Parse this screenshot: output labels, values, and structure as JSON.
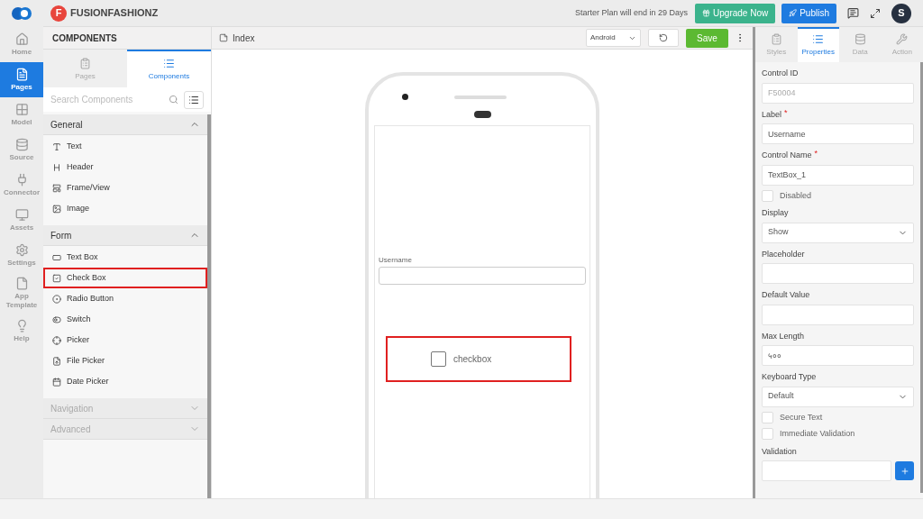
{
  "rail": {
    "items": [
      {
        "label": "Home",
        "selected": false
      },
      {
        "label": "Pages",
        "selected": true
      },
      {
        "label": "Model",
        "selected": false
      },
      {
        "label": "Source",
        "selected": false
      },
      {
        "label": "Connector",
        "selected": false
      },
      {
        "label": "Assets",
        "selected": false
      },
      {
        "label": "Settings",
        "selected": false
      },
      {
        "label": "App Template",
        "selected": false
      },
      {
        "label": "Help",
        "selected": false
      }
    ]
  },
  "brand": {
    "initial": "F",
    "name": "FUSIONFASHIONZ"
  },
  "topbar": {
    "notice": "Starter Plan will end in 29 Days",
    "upgrade": "Upgrade Now",
    "publish": "Publish",
    "avatar": "S"
  },
  "components_panel": {
    "title": "COMPONENTS",
    "tabs": [
      {
        "label": "Pages",
        "selected": false
      },
      {
        "label": "Components",
        "selected": true
      }
    ],
    "search": {
      "placeholder": "Search Components"
    },
    "sections": [
      {
        "title": "General",
        "expanded": true,
        "items": [
          {
            "label": "Text",
            "highlighted": false
          },
          {
            "label": "Header",
            "highlighted": false
          },
          {
            "label": "Frame/View",
            "highlighted": false
          },
          {
            "label": "Image",
            "highlighted": false
          }
        ]
      },
      {
        "title": "Form",
        "expanded": true,
        "items": [
          {
            "label": "Text Box",
            "highlighted": false
          },
          {
            "label": "Check Box",
            "highlighted": true
          },
          {
            "label": "Radio Button",
            "highlighted": false
          },
          {
            "label": "Switch",
            "highlighted": false
          },
          {
            "label": "Picker",
            "highlighted": false
          },
          {
            "label": "File Picker",
            "highlighted": false
          },
          {
            "label": "Date Picker",
            "highlighted": false
          }
        ]
      },
      {
        "title": "Navigation",
        "expanded": false
      },
      {
        "title": "Advanced",
        "expanded": false
      }
    ]
  },
  "canvas": {
    "page_title": "Index",
    "platform": "Android",
    "save": "Save",
    "phone": {
      "field_label": "Username",
      "checkbox": {
        "label": "checkbox",
        "checked": false,
        "highlighted": true
      }
    }
  },
  "properties": {
    "tabs": [
      {
        "label": "Styles",
        "selected": false
      },
      {
        "label": "Properties",
        "selected": true
      },
      {
        "label": "Data",
        "selected": false
      },
      {
        "label": "Action",
        "selected": false
      }
    ],
    "fields": [
      {
        "kind": "text",
        "label": "Control ID",
        "value": "F50004",
        "disabled": true
      },
      {
        "kind": "text",
        "label": "Label",
        "required_mark": "*",
        "value": "Username",
        "disabled": false
      },
      {
        "kind": "text",
        "label": "Control Name",
        "required_mark": "*",
        "value": "TextBox_1",
        "disabled": false
      },
      {
        "kind": "check",
        "label": "Disabled",
        "checked": false
      },
      {
        "kind": "select",
        "label": "Display",
        "value": "Show"
      },
      {
        "kind": "text",
        "label": "Placeholder"
      },
      {
        "kind": "text",
        "label": "Default Value"
      },
      {
        "kind": "text",
        "label": "Max Length",
        "value": "५००",
        "disabled": false
      },
      {
        "kind": "select",
        "label": "Keyboard Type",
        "value": "Default"
      },
      {
        "kind": "check",
        "label": "Secure Text",
        "checked": false
      },
      {
        "kind": "check",
        "label": "Immediate Validation",
        "checked": false
      },
      {
        "kind": "add",
        "label": "Validation"
      }
    ]
  }
}
